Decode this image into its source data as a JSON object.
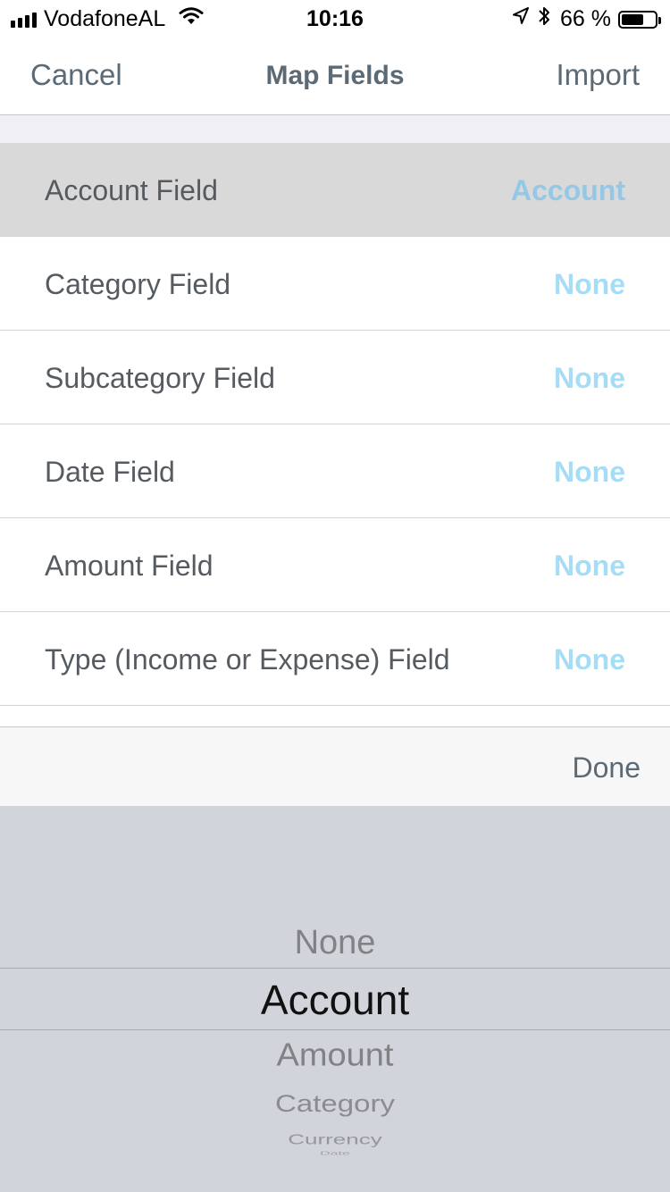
{
  "status_bar": {
    "carrier": "VodafoneAL",
    "time": "10:16",
    "battery_percent": "66 %",
    "battery_level": 0.66,
    "icons": [
      "signal-icon",
      "wifi-icon",
      "location-arrow-icon",
      "bluetooth-icon",
      "battery-icon"
    ]
  },
  "nav": {
    "cancel_label": "Cancel",
    "title": "Map Fields",
    "import_label": "Import"
  },
  "fields": [
    {
      "label": "Account Field",
      "value": "Account",
      "selected": true
    },
    {
      "label": "Category Field",
      "value": "None"
    },
    {
      "label": "Subcategory Field",
      "value": "None"
    },
    {
      "label": "Date Field",
      "value": "None"
    },
    {
      "label": "Amount Field",
      "value": "None"
    },
    {
      "label": "Type (Income or Expense) Field",
      "value": "None"
    }
  ],
  "picker_toolbar": {
    "done_label": "Done"
  },
  "picker": {
    "options": [
      "None",
      "Account",
      "Amount",
      "Category",
      "Currency",
      "Date"
    ],
    "selected": "Account"
  },
  "colors": {
    "accent_value": "#a6ddf6",
    "nav_text": "#5c6a76",
    "selected_row": "#d9d9d9",
    "picker_background": "#d1d4da"
  }
}
